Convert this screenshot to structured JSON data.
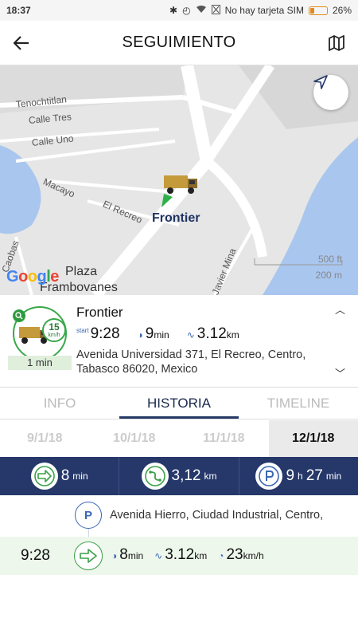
{
  "status_bar": {
    "time": "18:37",
    "carrier": "No hay tarjeta SIM",
    "battery": "26%"
  },
  "header": {
    "title": "SEGUIMIENTO"
  },
  "map": {
    "streets": {
      "tenochtitlan": "Tenochtitlan",
      "calle_tres": "Calle Tres",
      "calle_uno": "Calle Uno",
      "macayo": "Macayo",
      "el_recreo": "El Recreo",
      "caobas": "Caobas",
      "javier_mina": "Javier Mina"
    },
    "place_line1": "Plaza",
    "place_line2": "Frambovanes",
    "vehicle_label": "Frontier",
    "google": "Google",
    "scale_ft": "500 ft",
    "scale_m": "200 m"
  },
  "vehicle": {
    "name": "Frontier",
    "speed_value": "15",
    "speed_unit": "km/h",
    "duration": "1 min",
    "start_label": "start",
    "start_time": "9:28",
    "minutes_value": "9",
    "minutes_unit": "min",
    "distance_value": "3.12",
    "distance_unit": "km",
    "address": "Avenida Universidad 371, El Recreo, Centro, Tabasco 86020, Mexico"
  },
  "tabs": [
    {
      "label": "INFO"
    },
    {
      "label": "HISTORIA"
    },
    {
      "label": "TIMELINE"
    }
  ],
  "dates": [
    "9/1/18",
    "10/1/18",
    "11/1/18",
    "12/1/18"
  ],
  "summary": {
    "drive_value": "8",
    "drive_unit": "min",
    "distance_value": "3,12",
    "distance_unit": "km",
    "park_hours": "9",
    "park_h_unit": "h",
    "park_minutes": "27",
    "park_min_unit": "min"
  },
  "timeline": {
    "park_address": "Avenida Hierro, Ciudad Industrial, Centro,",
    "trip_time": "9:28",
    "trip_minutes": "8",
    "trip_minutes_unit": "min",
    "trip_distance": "3.12",
    "trip_distance_unit": "km",
    "trip_speed": "23",
    "trip_speed_unit": "km/h"
  },
  "colors": {
    "navy": "#26386a",
    "green": "#39a84a",
    "blue_accent": "#3a68b5",
    "battery": "#e08a1e"
  }
}
